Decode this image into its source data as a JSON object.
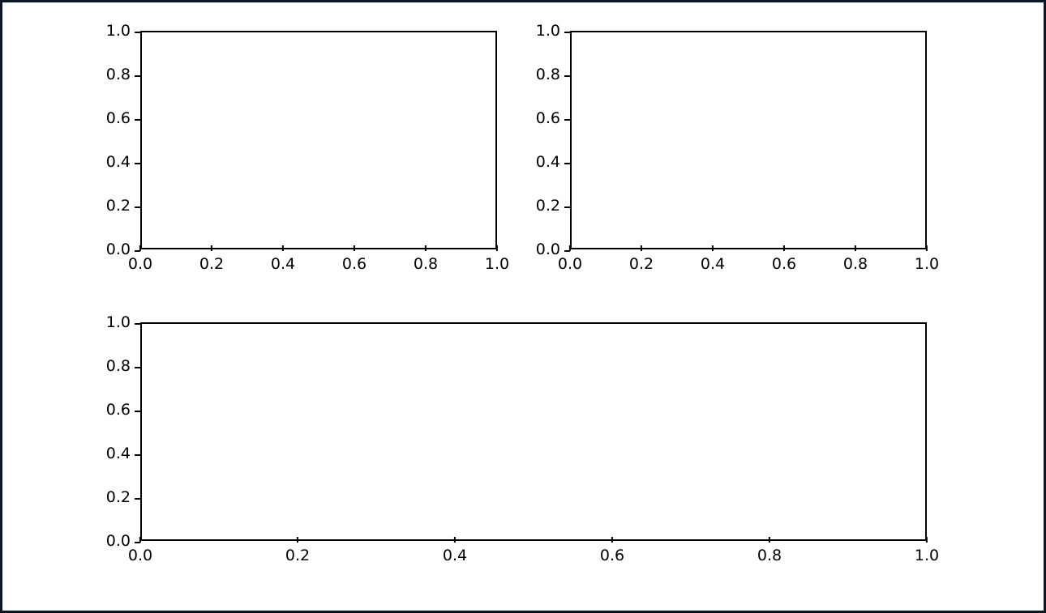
{
  "chart_data": [
    {
      "type": "line",
      "title": "",
      "xlabel": "",
      "ylabel": "",
      "xlim": [
        0.0,
        1.0
      ],
      "ylim": [
        0.0,
        1.0
      ],
      "xticks": [
        0.0,
        0.2,
        0.4,
        0.6,
        0.8,
        1.0
      ],
      "yticks": [
        0.0,
        0.2,
        0.4,
        0.6,
        0.8,
        1.0
      ],
      "series": []
    },
    {
      "type": "line",
      "title": "",
      "xlabel": "",
      "ylabel": "",
      "xlim": [
        0.0,
        1.0
      ],
      "ylim": [
        0.0,
        1.0
      ],
      "xticks": [
        0.0,
        0.2,
        0.4,
        0.6,
        0.8,
        1.0
      ],
      "yticks": [
        0.0,
        0.2,
        0.4,
        0.6,
        0.8,
        1.0
      ],
      "series": []
    },
    {
      "type": "line",
      "title": "",
      "xlabel": "",
      "ylabel": "",
      "xlim": [
        0.0,
        1.0
      ],
      "ylim": [
        0.0,
        1.0
      ],
      "xticks": [
        0.0,
        0.2,
        0.4,
        0.6,
        0.8,
        1.0
      ],
      "yticks": [
        0.0,
        0.2,
        0.4,
        0.6,
        0.8,
        1.0
      ],
      "series": []
    }
  ],
  "layout": {
    "panels": [
      {
        "class": "small",
        "left": 0,
        "top": 10,
        "data_index": 0,
        "name": "axes-top-left"
      },
      {
        "class": "small",
        "left": 530,
        "top": 10,
        "data_index": 1,
        "name": "axes-top-right"
      },
      {
        "class": "wide",
        "left": 0,
        "top": 370,
        "data_index": 2,
        "name": "axes-bottom"
      }
    ]
  }
}
